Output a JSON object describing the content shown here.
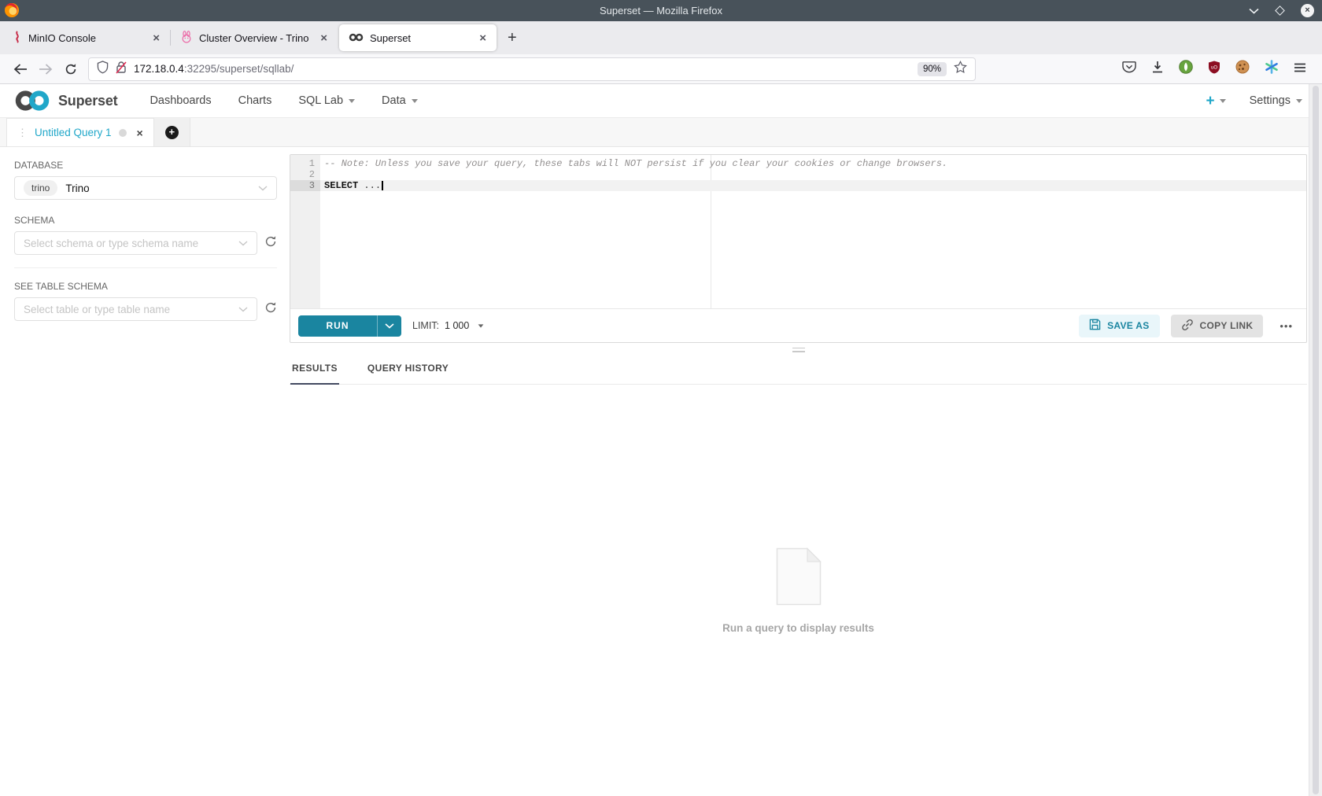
{
  "glyphs": {
    "close": "×",
    "tab_drag": "⋮",
    "new_tab": "+"
  },
  "window": {
    "title": "Superset — Mozilla Firefox"
  },
  "browser_tabs": [
    {
      "title": "MinIO Console"
    },
    {
      "title": "Cluster Overview - Trino"
    },
    {
      "title": "Superset"
    }
  ],
  "urlbar": {
    "host": "172.18.0.4",
    "path": ":32295/superset/sqllab/",
    "zoom": "90%"
  },
  "navbar": {
    "brand": "Superset",
    "items": [
      {
        "label": "Dashboards"
      },
      {
        "label": "Charts"
      },
      {
        "label": "SQL Lab"
      },
      {
        "label": "Data"
      }
    ],
    "new_shortcut": "+",
    "settings": "Settings"
  },
  "query_tab": {
    "title": "Untitled Query 1"
  },
  "sidebar": {
    "database_label": "DATABASE",
    "database_badge": "trino",
    "database_name": "Trino",
    "schema_label": "SCHEMA",
    "schema_placeholder": "Select schema or type schema name",
    "table_label": "SEE TABLE SCHEMA",
    "table_placeholder": "Select table or type table name"
  },
  "editor": {
    "line_numbers": [
      "1",
      "2",
      "3"
    ],
    "comment": "-- Note: Unless you save your query, these tabs will NOT persist if you clear your cookies or change browsers.",
    "keyword": "SELECT",
    "code_rest": " ..."
  },
  "toolbar": {
    "run": "RUN",
    "limit_label": "LIMIT:",
    "limit_value": "1 000",
    "save_as": "SAVE AS",
    "copy_link": "COPY LINK",
    "more": "•••"
  },
  "results": {
    "tab_results": "RESULTS",
    "tab_history": "QUERY HISTORY",
    "empty_message": "Run a query to display results"
  },
  "colors": {
    "accent": "#20a7c9",
    "run_button": "#1a85a0",
    "active_tab_ink": "#434a60"
  }
}
